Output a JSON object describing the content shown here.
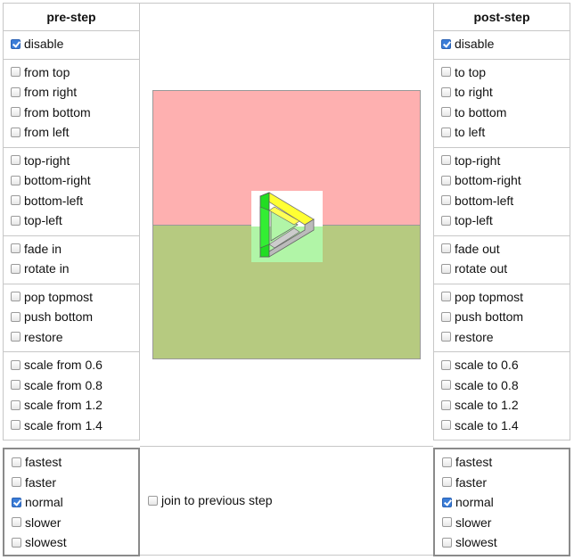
{
  "pre_step": {
    "header": "pre-step",
    "groups": [
      [
        {
          "label": "disable",
          "checked": true
        }
      ],
      [
        {
          "label": "from top"
        },
        {
          "label": "from right"
        },
        {
          "label": "from bottom"
        },
        {
          "label": "from left"
        }
      ],
      [
        {
          "label": "top-right"
        },
        {
          "label": "bottom-right"
        },
        {
          "label": "bottom-left"
        },
        {
          "label": "top-left"
        }
      ],
      [
        {
          "label": "fade in"
        },
        {
          "label": "rotate in"
        }
      ],
      [
        {
          "label": "pop topmost"
        },
        {
          "label": "push bottom"
        },
        {
          "label": "restore"
        }
      ],
      [
        {
          "label": "scale from 0.6"
        },
        {
          "label": "scale from 0.8"
        },
        {
          "label": "scale from 1.2"
        },
        {
          "label": "scale from 1.4"
        }
      ]
    ],
    "speed": [
      {
        "label": "fastest"
      },
      {
        "label": "faster"
      },
      {
        "label": "normal",
        "checked": true
      },
      {
        "label": "slower"
      },
      {
        "label": "slowest"
      }
    ]
  },
  "post_step": {
    "header": "post-step",
    "groups": [
      [
        {
          "label": "disable",
          "checked": true
        }
      ],
      [
        {
          "label": "to top"
        },
        {
          "label": "to right"
        },
        {
          "label": "to bottom"
        },
        {
          "label": "to left"
        }
      ],
      [
        {
          "label": "top-right"
        },
        {
          "label": "bottom-right"
        },
        {
          "label": "bottom-left"
        },
        {
          "label": "top-left"
        }
      ],
      [
        {
          "label": "fade out"
        },
        {
          "label": "rotate out"
        }
      ],
      [
        {
          "label": "pop topmost"
        },
        {
          "label": "push bottom"
        },
        {
          "label": "restore"
        }
      ],
      [
        {
          "label": "scale to 0.6"
        },
        {
          "label": "scale to 0.8"
        },
        {
          "label": "scale to 1.2"
        },
        {
          "label": "scale to 1.4"
        }
      ]
    ],
    "speed": [
      {
        "label": "fastest"
      },
      {
        "label": "faster"
      },
      {
        "label": "normal",
        "checked": true
      },
      {
        "label": "slower"
      },
      {
        "label": "slowest"
      }
    ]
  },
  "preview": {
    "colors": {
      "top": "#feb0b0",
      "bottom": "#b6ca80",
      "thumb_top": "#ffffff",
      "thumb_bottom": "#b1f5a7"
    },
    "icon": "impossible-triangle-play-icon"
  },
  "join": {
    "label": "join to previous step",
    "checked": false
  }
}
